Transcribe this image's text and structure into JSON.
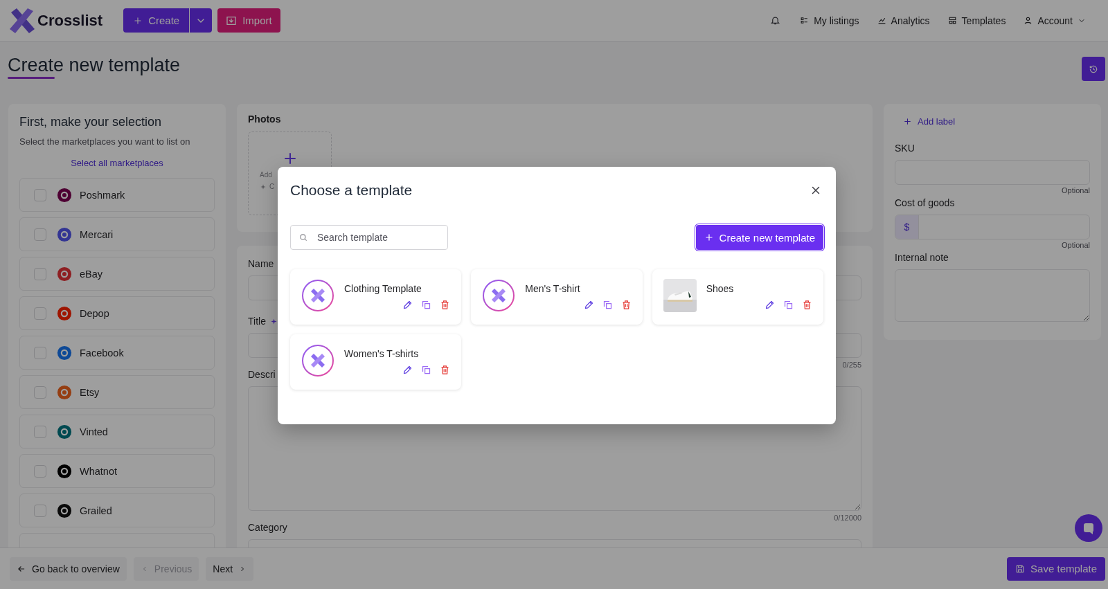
{
  "nav": {
    "brand": "Crosslist",
    "create_button": "Create",
    "import_button": "Import",
    "links": [
      {
        "label": "My listings"
      },
      {
        "label": "Analytics"
      },
      {
        "label": "Templates"
      },
      {
        "label": "Account",
        "dropdown": true
      }
    ]
  },
  "page_title": "Create new template",
  "selection_panel": {
    "title": "First, make your selection",
    "subtitle": "Select the marketplaces you want to list on",
    "select_all": "Select all marketplaces",
    "marketplaces": [
      {
        "name": "Poshmark",
        "checked": false
      },
      {
        "name": "Mercari",
        "checked": false
      },
      {
        "name": "eBay",
        "checked": false
      },
      {
        "name": "Depop",
        "checked": false
      },
      {
        "name": "Facebook",
        "checked": false
      },
      {
        "name": "Etsy",
        "checked": false
      },
      {
        "name": "Vinted",
        "checked": false
      },
      {
        "name": "Whatnot",
        "checked": false
      },
      {
        "name": "Grailed",
        "checked": false
      }
    ]
  },
  "photos": {
    "label": "Photos",
    "add_text": "Add",
    "second_text": "C"
  },
  "details": {
    "name_label": "Name",
    "title_label": "Title",
    "title_counter": "0/255",
    "description_label": "Descri",
    "description_counter": "0/12000",
    "category_label": "Category"
  },
  "side_panel": {
    "add_label": "Add label",
    "sku_label": "SKU",
    "sku_hint": "Optional",
    "cost_label": "Cost of goods",
    "currency": "$",
    "cost_hint": "Optional",
    "note_label": "Internal note"
  },
  "footer": {
    "back": "Go back to overview",
    "previous": "Previous",
    "next": "Next",
    "save": "Save template",
    "previous_disabled": true
  },
  "modal": {
    "title": "Choose a template",
    "search": {
      "placeholder": "Search template"
    },
    "create_button": "Create new template",
    "templates": [
      {
        "name": "Clothing Template",
        "kind": "logo"
      },
      {
        "name": "Men's T-shirt",
        "kind": "logo"
      },
      {
        "name": "Shoes",
        "kind": "picture"
      },
      {
        "name": "Women's T-shirts",
        "kind": "logo"
      }
    ]
  }
}
